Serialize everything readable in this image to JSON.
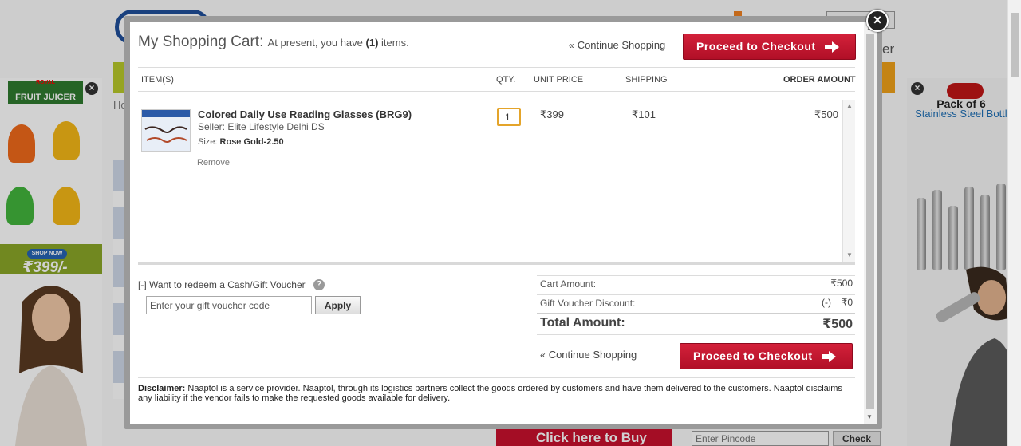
{
  "background": {
    "left_ad": {
      "brand_top": "ROYAL",
      "brand": "FRUIT JUICER",
      "shop_label": "SHOP NOW",
      "price": "₹399/-"
    },
    "right_ad": {
      "pack_text": "Pack of 6",
      "product_text": "Stainless Steel Bottle"
    },
    "home_crumb": "Ho",
    "right_partial": "er",
    "buy_button": "Click here to Buy",
    "pincode_placeholder": "Enter Pincode",
    "check_button": "Check"
  },
  "cart": {
    "title": "My Shopping Cart:",
    "subtitle_pre": "At present, you have",
    "item_count": "(1)",
    "subtitle_post": "items.",
    "continue_shopping": "Continue Shopping",
    "checkout_label": "Proceed to Checkout",
    "columns": {
      "items": "ITEM(S)",
      "qty": "QTY.",
      "unit_price": "UNIT PRICE",
      "shipping": "SHIPPING",
      "order_amount": "ORDER AMOUNT"
    },
    "items": [
      {
        "name": "Colored Daily Use Reading Glasses (BRG9)",
        "seller": "Seller: Elite Lifestyle Delhi DS",
        "size_label": "Size:",
        "size_value": "Rose Gold-2.50",
        "remove_label": "Remove",
        "qty": "1",
        "unit_price": "399",
        "shipping": "101",
        "order_amount": "500"
      }
    ],
    "voucher": {
      "toggle_label": "[-] Want to redeem a Cash/Gift Voucher",
      "placeholder": "Enter your gift voucher code",
      "apply_label": "Apply"
    },
    "summary": {
      "cart_amount_label": "Cart Amount:",
      "cart_amount": "500",
      "discount_label": "Gift Voucher Discount:",
      "discount_sign": "(-)",
      "discount": "0",
      "total_label": "Total Amount:",
      "total": "500"
    },
    "currency_symbol": "₹",
    "disclaimer_label": "Disclaimer:",
    "disclaimer_text": "Naaptol is a service provider. Naaptol, through its logistics partners collect the goods ordered by customers and have them delivered to the customers. Naaptol disclaims any liability if the vendor fails to make the requested goods available for delivery."
  },
  "colors": {
    "checkout_red": "#c8102e",
    "qty_focus": "#e4a42a",
    "text_gray": "#555555"
  },
  "icons": {
    "close": "close-icon",
    "arrow": "arrow-right-icon",
    "help": "question-icon"
  }
}
